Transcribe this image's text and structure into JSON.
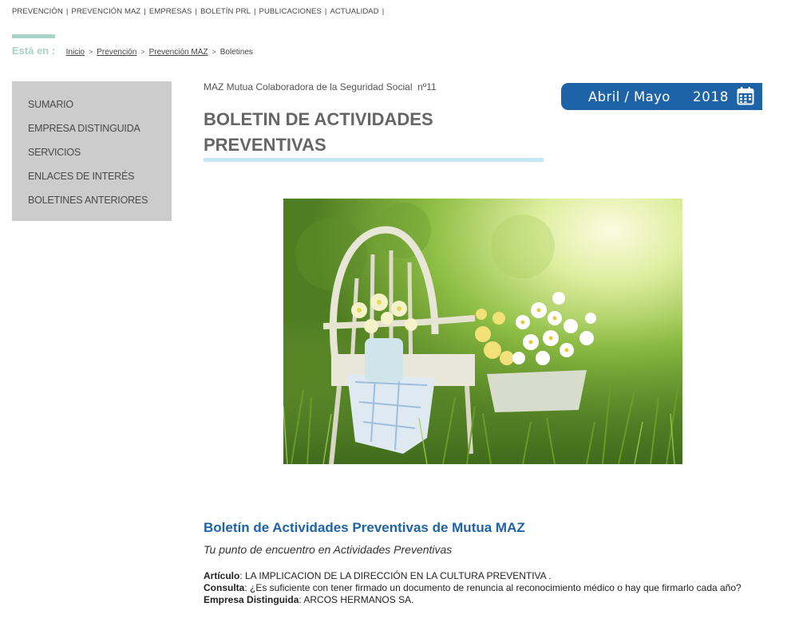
{
  "topnav": {
    "items": [
      "PREVENCIÓN",
      "PREVENCIÓN MAZ",
      "EMPRESAS",
      "BOLETÍN PRL",
      "PUBLICACIONES",
      "ACTUALIDAD"
    ],
    "separator": "|"
  },
  "breadcrumb": {
    "label": "Está en :",
    "links": [
      "Inicio",
      "Prevención",
      "Prevención MAZ"
    ],
    "separator": ">",
    "current": "Boletines"
  },
  "sidebar": {
    "items": [
      "SUMARIO",
      "EMPRESA DISTINGUIDA",
      "SERVICIOS",
      "ENLACES DE INTERÉS",
      "BOLETINES ANTERIORES"
    ]
  },
  "header": {
    "publisher": "MAZ Mutua Colaboradora de la Seguridad Social  nº11",
    "title_line1": "BOLETIN DE ACTIVIDADES",
    "title_line2": "PREVENTIVAS"
  },
  "date_badge": {
    "months": "Abril / Mayo",
    "year": "2018",
    "icon": "calendar-icon"
  },
  "hero": {
    "description_icon": "garden-chair-flowers-photo"
  },
  "intro": {
    "heading": "Boletín de Actividades Preventivas de Mutua MAZ",
    "tagline": "Tu punto de encuentro en Actividades Preventivas"
  },
  "summary": {
    "articulo_label": "Artículo",
    "articulo_text": ": LA IMPLICACION DE LA DIRECCIÓN EN LA CULTURA PREVENTIVA .",
    "consulta_label": "Consulta",
    "consulta_text": ": ¿Es suficiente con tener firmado un documento de renuncia al reconocimiento médico o hay que firmarlo cada año?",
    "empresa_label": "Empresa Distinguida",
    "empresa_text": ": ARCOS HERMANOS SA."
  },
  "colors": {
    "brand_blue": "#1e63a8",
    "mint": "#a9d3c8",
    "light_blue_bar": "#c5e6f3",
    "sidebar_bg": "#cccccc"
  }
}
